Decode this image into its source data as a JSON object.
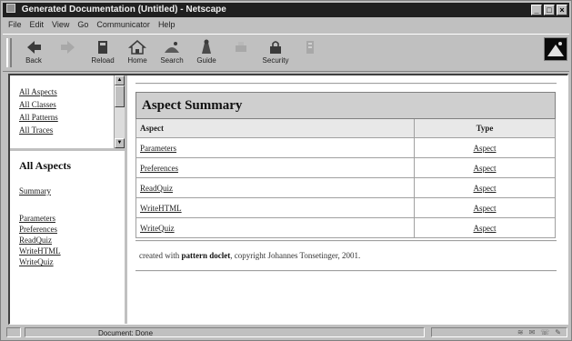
{
  "window": {
    "title": "Generated Documentation (Untitled) - Netscape",
    "controls": [
      "_",
      "□",
      "×"
    ]
  },
  "menu": [
    "File",
    "Edit",
    "View",
    "Go",
    "Communicator",
    "Help"
  ],
  "toolbar": {
    "buttons": [
      {
        "label": "Back",
        "icon": "back-arrow-icon",
        "enabled": true
      },
      {
        "label": "",
        "icon": "forward-arrow-icon",
        "enabled": false
      },
      {
        "label": "Reload",
        "icon": "reload-icon",
        "enabled": true
      },
      {
        "label": "Home",
        "icon": "home-icon",
        "enabled": true
      },
      {
        "label": "Search",
        "icon": "search-icon",
        "enabled": true
      },
      {
        "label": "Guide",
        "icon": "guide-icon",
        "enabled": true
      },
      {
        "label": "",
        "icon": "print-icon",
        "enabled": false
      },
      {
        "label": "Security",
        "icon": "security-icon",
        "enabled": true
      },
      {
        "label": "",
        "icon": "stop-icon",
        "enabled": false
      }
    ]
  },
  "left_top_frame": {
    "links": [
      "All Aspects",
      "All Classes",
      "All Patterns",
      "All Traces"
    ]
  },
  "left_bottom_frame": {
    "heading": "All Aspects",
    "summary_link": "Summary",
    "links": [
      "Parameters",
      "Preferences",
      "ReadQuiz",
      "WriteHTML",
      "WriteQuiz"
    ]
  },
  "main": {
    "table_title": "Aspect Summary",
    "columns": [
      "Aspect",
      "Type"
    ],
    "rows": [
      {
        "aspect": "Parameters",
        "type": "Aspect"
      },
      {
        "aspect": "Preferences",
        "type": "Aspect"
      },
      {
        "aspect": "ReadQuiz",
        "type": "Aspect"
      },
      {
        "aspect": "WriteHTML",
        "type": "Aspect"
      },
      {
        "aspect": "WriteQuiz",
        "type": "Aspect"
      }
    ],
    "footer_prefix": "created with ",
    "footer_bold": "pattern doclet",
    "footer_suffix": ", copyright Johannes Tonsetinger, 2001."
  },
  "status": {
    "text": "Document: Done"
  },
  "colors": {
    "titlebar": "#202020",
    "chrome": "#c0c0c0",
    "table_header": "#cfcfcf"
  }
}
